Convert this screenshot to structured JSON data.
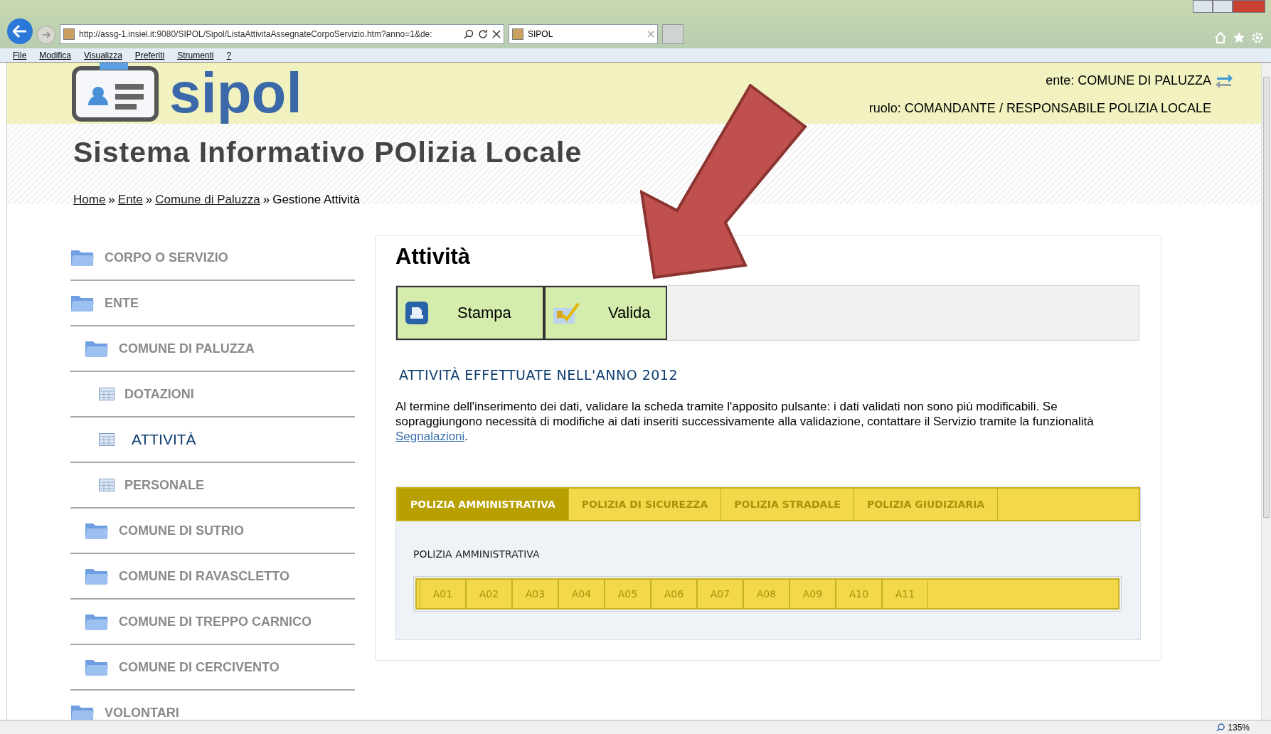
{
  "browser": {
    "url": "http://assg-1.insiel.it:9080/SIPOL/Sipol/ListaAttivitaAssegnateCorpoServizio.htm?anno=1&de:",
    "tab_title": "SIPOL",
    "menu": [
      "File",
      "Modifica",
      "Visualizza",
      "Preferiti",
      "Strumenti",
      "?"
    ],
    "zoom": "135%"
  },
  "header": {
    "logo": "sipol",
    "ente": "ente: COMUNE DI PALUZZA",
    "ruolo": "ruolo: COMANDANTE / RESPONSABILE POLIZIA LOCALE",
    "title": "Sistema Informativo POlizia Locale",
    "breadcrumb_separator": "»",
    "breadcrumb": [
      {
        "label": "Home",
        "link": true
      },
      {
        "label": "Ente",
        "link": true
      },
      {
        "label": "Comune di Paluzza",
        "link": true
      },
      {
        "label": "Gestione Attività",
        "link": false
      }
    ]
  },
  "sidebar": [
    {
      "label": "CORPO O SERVIZIO",
      "kind": "folder",
      "selected": false
    },
    {
      "label": "ENTE",
      "kind": "folder",
      "selected": false,
      "children": [
        {
          "label": "COMUNE DI PALUZZA",
          "kind": "folder",
          "selected": false,
          "children": [
            {
              "label": "DOTAZIONI",
              "kind": "page",
              "selected": false
            },
            {
              "label": "ATTIVITÀ",
              "kind": "page",
              "selected": true
            },
            {
              "label": "PERSONALE",
              "kind": "page",
              "selected": false
            }
          ]
        },
        {
          "label": "COMUNE DI SUTRIO",
          "kind": "folder",
          "selected": false
        },
        {
          "label": "COMUNE DI RAVASCLETTO",
          "kind": "folder",
          "selected": false
        },
        {
          "label": "COMUNE DI TREPPO CARNICO",
          "kind": "folder",
          "selected": false
        },
        {
          "label": "COMUNE DI CERCIVENTO",
          "kind": "folder",
          "selected": false
        }
      ]
    },
    {
      "label": "VOLONTARI",
      "kind": "folder",
      "selected": false
    }
  ],
  "content": {
    "title": "Attività",
    "buttons": [
      {
        "label": "Stampa",
        "kind": "print"
      },
      {
        "label": "Valida",
        "kind": "validate"
      }
    ],
    "section_heading": "ATTIVITÀ EFFETTUATE NELL'ANNO 2012",
    "paragraph": "Al termine dell'inserimento dei dati, validare la scheda tramite l'apposito pulsante: i dati validati non sono più modificabili. Se sopraggiungono necessità di modifiche ai dati inseriti successivamente alla validazione, contattare il Servizio tramite la funzionalità",
    "link": "Segnalazioni",
    "after_link": ".",
    "tabs": [
      {
        "label": "POLIZIA AMMINISTRATIVA",
        "selected": true
      },
      {
        "label": "POLIZIA DI SICUREZZA",
        "selected": false
      },
      {
        "label": "POLIZIA STRADALE",
        "selected": false
      },
      {
        "label": "POLIZIA GIUDIZIARIA",
        "selected": false
      }
    ],
    "tab_heading": "POLIZIA AMMINISTRATIVA",
    "subtabs": [
      "A01",
      "A02",
      "A03",
      "A04",
      "A05",
      "A06",
      "A07",
      "A08",
      "A09",
      "A10",
      "A11"
    ]
  }
}
